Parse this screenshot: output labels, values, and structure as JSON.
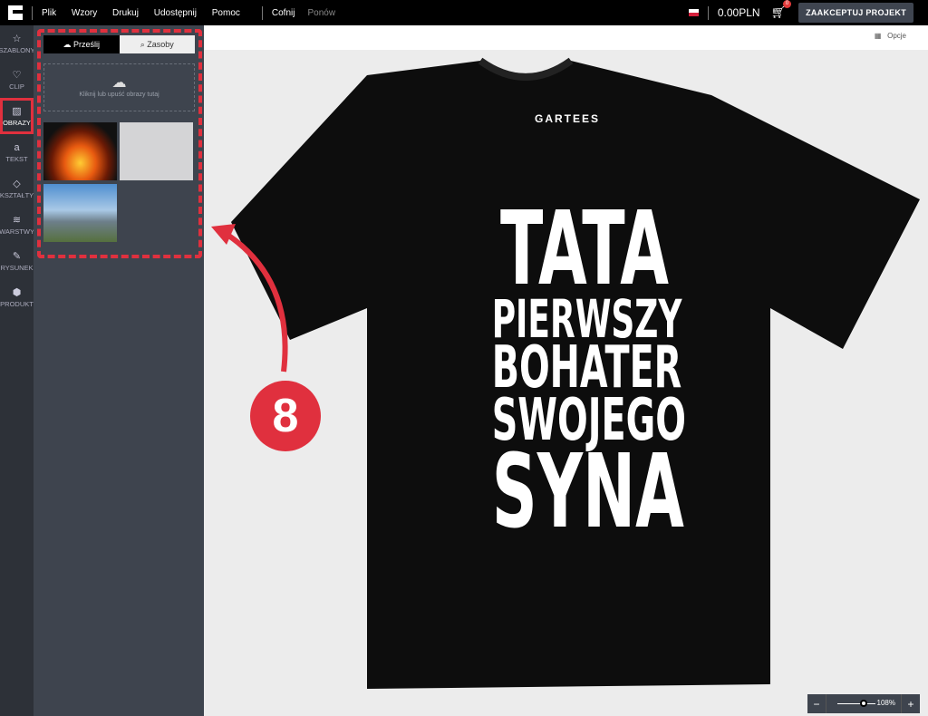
{
  "topbar": {
    "menu": [
      "Plik",
      "Wzory",
      "Drukuj",
      "Udostępnij",
      "Pomoc"
    ],
    "undo": "Cofnij",
    "redo": "Ponów",
    "price": "0.00PLN",
    "cart_count": "0",
    "accept": "ZAAKCEPTUJ PROJEKT"
  },
  "rail": [
    {
      "label": "SZABLONY",
      "icon": "star-icon"
    },
    {
      "label": "CLIP",
      "icon": "heart-icon"
    },
    {
      "label": "OBRAZY",
      "icon": "image-icon"
    },
    {
      "label": "TEKST",
      "icon": "text-icon"
    },
    {
      "label": "KSZTAŁTY",
      "icon": "diamond-icon"
    },
    {
      "label": "WARSTWY",
      "icon": "layers-icon"
    },
    {
      "label": "RYSUNEK",
      "icon": "edit-icon"
    },
    {
      "label": "PRODUKT",
      "icon": "cube-icon"
    }
  ],
  "panel": {
    "tab_upload": "Prześlij",
    "tab_assets": "Zasoby",
    "drop_text": "Kliknij lub upuść obrazy tutaj"
  },
  "canvas": {
    "options": "Opcje",
    "zoom": "108%",
    "brand": "GARTEES",
    "design": [
      "TATA",
      "PIERWSZY",
      "BOHATER",
      "SWOJEGO",
      "SYNA"
    ]
  },
  "annotation": {
    "number": "8",
    "color": "#e0303e"
  }
}
